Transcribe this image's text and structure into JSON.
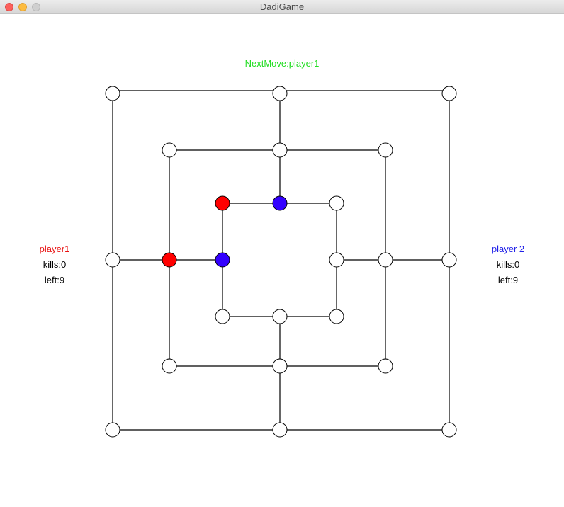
{
  "window": {
    "title": "DadiGame"
  },
  "status": {
    "next_move": "NextMove:player1"
  },
  "player1": {
    "name": "player1",
    "kills": "kills:0",
    "left": "left:9"
  },
  "player2": {
    "name": "player 2",
    "kills": "kills:0",
    "left": "left:9"
  },
  "colors": {
    "player1": "#ff0000",
    "player2": "#3300ff",
    "empty": "#ffffff",
    "status_text": "#22dd22",
    "player1_label": "#e81010",
    "player2_label": "#2020e8"
  },
  "board": {
    "rings": [
      "outer",
      "middle",
      "inner"
    ],
    "pieces": {
      "outer": [
        "empty",
        "empty",
        "empty",
        "empty",
        "empty",
        "empty",
        "empty",
        "empty"
      ],
      "middle": [
        "empty",
        "empty",
        "empty",
        "empty",
        "empty",
        "empty",
        "empty",
        "player1"
      ],
      "inner": [
        "player1",
        "player2",
        "empty",
        "empty",
        "empty",
        "empty",
        "empty",
        "player2"
      ]
    }
  }
}
